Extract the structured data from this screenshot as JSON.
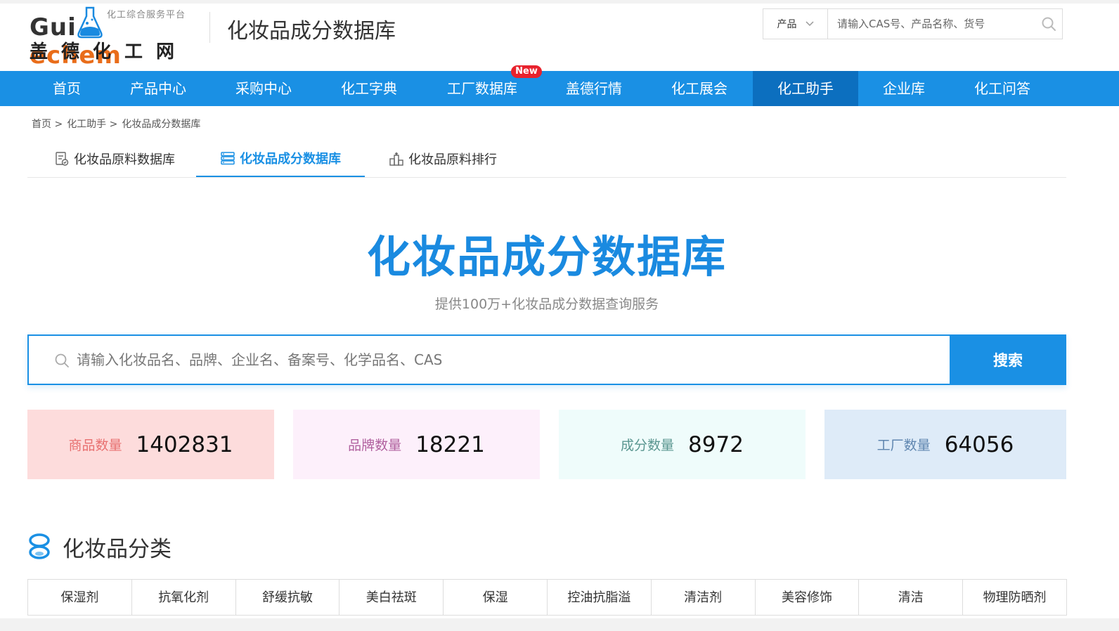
{
  "logo": {
    "tagline": "化工综合服务平台",
    "en_part1": "Gui",
    "en_part2": "echem",
    "cn": "盖德化工网"
  },
  "header": {
    "site_title": "化妆品成分数据库",
    "search_category": "产品",
    "search_placeholder": "请输入CAS号、产品名称、货号"
  },
  "nav": {
    "items": [
      {
        "label": "首页"
      },
      {
        "label": "产品中心"
      },
      {
        "label": "采购中心"
      },
      {
        "label": "化工字典"
      },
      {
        "label": "工厂数据库"
      },
      {
        "label": "盖德行情"
      },
      {
        "label": "化工展会"
      },
      {
        "label": "化工助手"
      },
      {
        "label": "企业库"
      },
      {
        "label": "化工问答"
      }
    ],
    "active": "化工助手",
    "new_badge": "New"
  },
  "breadcrumb": [
    "首页 >",
    "化工助手 >",
    "化妆品成分数据库"
  ],
  "tabs": [
    {
      "label": "化妆品原料数据库"
    },
    {
      "label": "化妆品成分数据库"
    },
    {
      "label": "化妆品原料排行"
    }
  ],
  "hero": {
    "title": "化妆品成分数据库",
    "subtitle": "提供100万+化妆品成分数据查询服务",
    "search_placeholder": "请输入化妆品名、品牌、企业名、备案号、化学品名、CAS",
    "search_button": "搜索"
  },
  "stats": [
    {
      "label": "商品数量",
      "value": "1402831",
      "bg": "#fddcdc",
      "label_color": "#e87070"
    },
    {
      "label": "品牌数量",
      "value": "18221",
      "bg": "#fdf0fb",
      "label_color": "#b0609e"
    },
    {
      "label": "成分数量",
      "value": "8972",
      "bg": "#effcfb",
      "label_color": "#5a9690"
    },
    {
      "label": "工厂数量",
      "value": "64056",
      "bg": "#deebf8",
      "label_color": "#5f86b0"
    }
  ],
  "category": {
    "title": "化妆品分类",
    "items": [
      "保湿剂",
      "抗氧化剂",
      "舒缓抗敏",
      "美白祛斑",
      "保湿",
      "控油抗脂溢",
      "清洁剂",
      "美容修饰",
      "清洁",
      "物理防晒剂"
    ]
  },
  "colors": {
    "primary": "#1a90e4",
    "nav_active": "#0c6fbf",
    "badge_red": "#e8222d",
    "logo_orange": "#e96d1a"
  }
}
